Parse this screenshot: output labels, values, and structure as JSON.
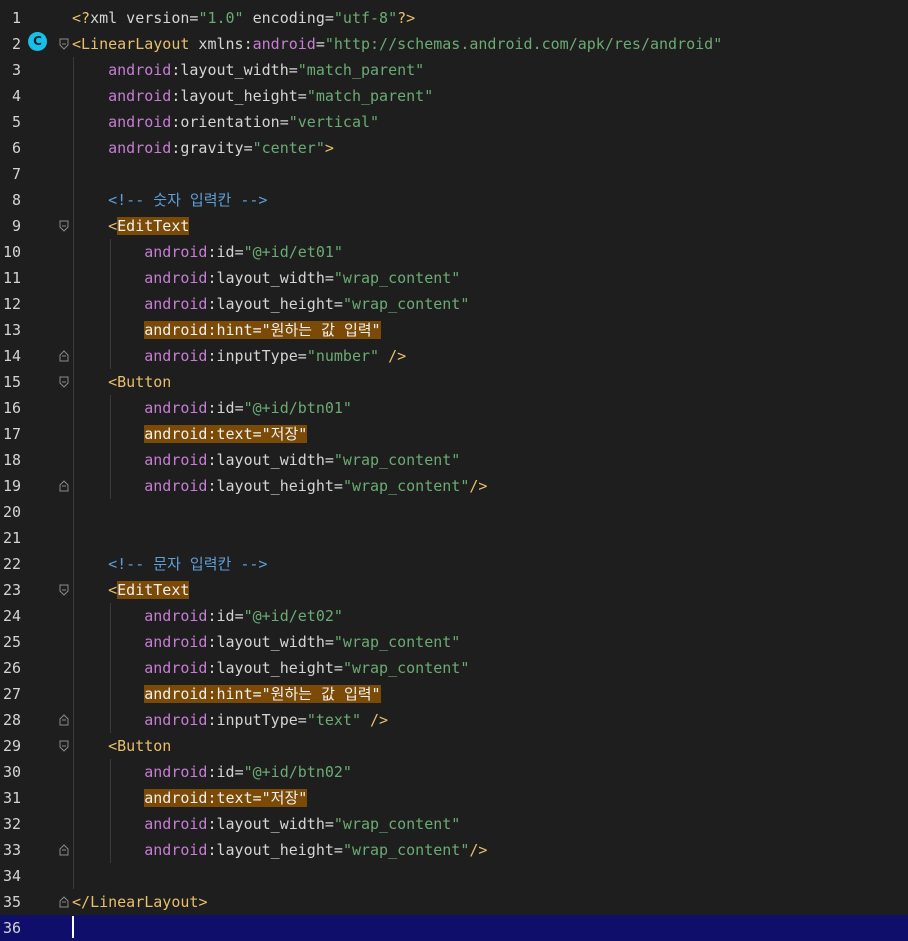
{
  "editor": {
    "gutter_badge": "C",
    "current_line": 36,
    "lines": [
      {
        "n": "1",
        "tokens": [
          [
            "tk-punct",
            "<?"
          ],
          [
            "tk-text",
            "xml version"
          ],
          [
            "tk-eq",
            "="
          ],
          [
            "tk-str",
            "\"1.0\""
          ],
          [
            "tk-text",
            " encoding"
          ],
          [
            "tk-eq",
            "="
          ],
          [
            "tk-str",
            "\"utf-8\""
          ],
          [
            "tk-punct",
            "?>"
          ]
        ]
      },
      {
        "n": "2",
        "tokens": [
          [
            "tk-bracket",
            "<"
          ],
          [
            "tk-tag",
            "LinearLayout"
          ],
          [
            "tk-text",
            " xmlns"
          ],
          [
            "tk-eq",
            ":"
          ],
          [
            "tk-ns",
            "android"
          ],
          [
            "tk-eq",
            "="
          ],
          [
            "tk-str",
            "\"http://schemas.android.com/apk/res/android\""
          ]
        ]
      },
      {
        "n": "3",
        "tokens": [
          [
            "tk-text",
            "    "
          ],
          [
            "tk-ns",
            "android"
          ],
          [
            "tk-eq",
            ":"
          ],
          [
            "tk-attr",
            "layout_width"
          ],
          [
            "tk-eq",
            "="
          ],
          [
            "tk-str",
            "\"match_parent\""
          ]
        ]
      },
      {
        "n": "4",
        "tokens": [
          [
            "tk-text",
            "    "
          ],
          [
            "tk-ns",
            "android"
          ],
          [
            "tk-eq",
            ":"
          ],
          [
            "tk-attr",
            "layout_height"
          ],
          [
            "tk-eq",
            "="
          ],
          [
            "tk-str",
            "\"match_parent\""
          ]
        ]
      },
      {
        "n": "5",
        "tokens": [
          [
            "tk-text",
            "    "
          ],
          [
            "tk-ns",
            "android"
          ],
          [
            "tk-eq",
            ":"
          ],
          [
            "tk-attr",
            "orientation"
          ],
          [
            "tk-eq",
            "="
          ],
          [
            "tk-str",
            "\"vertical\""
          ]
        ]
      },
      {
        "n": "6",
        "tokens": [
          [
            "tk-text",
            "    "
          ],
          [
            "tk-ns",
            "android"
          ],
          [
            "tk-eq",
            ":"
          ],
          [
            "tk-attr",
            "gravity"
          ],
          [
            "tk-eq",
            "="
          ],
          [
            "tk-str",
            "\"center\""
          ],
          [
            "tk-bracket",
            ">"
          ]
        ]
      },
      {
        "n": "7",
        "tokens": []
      },
      {
        "n": "8",
        "tokens": [
          [
            "tk-text",
            "    "
          ],
          [
            "tk-comment",
            "<!-- 숫자 입력칸 -->"
          ]
        ]
      },
      {
        "n": "9",
        "tokens": [
          [
            "tk-text",
            "    "
          ],
          [
            "tk-bracket",
            "<"
          ],
          [
            "tk-tag hl",
            "EditText"
          ]
        ]
      },
      {
        "n": "10",
        "tokens": [
          [
            "tk-text",
            "        "
          ],
          [
            "tk-ns",
            "android"
          ],
          [
            "tk-eq",
            ":"
          ],
          [
            "tk-attr",
            "id"
          ],
          [
            "tk-eq",
            "="
          ],
          [
            "tk-str",
            "\"@+id/et01\""
          ]
        ]
      },
      {
        "n": "11",
        "tokens": [
          [
            "tk-text",
            "        "
          ],
          [
            "tk-ns",
            "android"
          ],
          [
            "tk-eq",
            ":"
          ],
          [
            "tk-attr",
            "layout_width"
          ],
          [
            "tk-eq",
            "="
          ],
          [
            "tk-str",
            "\"wrap_content\""
          ]
        ]
      },
      {
        "n": "12",
        "tokens": [
          [
            "tk-text",
            "        "
          ],
          [
            "tk-ns",
            "android"
          ],
          [
            "tk-eq",
            ":"
          ],
          [
            "tk-attr",
            "layout_height"
          ],
          [
            "tk-eq",
            "="
          ],
          [
            "tk-str",
            "\"wrap_content\""
          ]
        ]
      },
      {
        "n": "13",
        "tokens": [
          [
            "tk-text",
            "        "
          ],
          [
            "hl",
            "android:hint=\"원하는 값 입력\""
          ]
        ]
      },
      {
        "n": "14",
        "tokens": [
          [
            "tk-text",
            "        "
          ],
          [
            "tk-ns",
            "android"
          ],
          [
            "tk-eq",
            ":"
          ],
          [
            "tk-attr",
            "inputType"
          ],
          [
            "tk-eq",
            "="
          ],
          [
            "tk-str",
            "\"number\""
          ],
          [
            "tk-text",
            " "
          ],
          [
            "tk-bracket",
            "/>"
          ]
        ]
      },
      {
        "n": "15",
        "tokens": [
          [
            "tk-text",
            "    "
          ],
          [
            "tk-bracket",
            "<"
          ],
          [
            "tk-tag",
            "Button"
          ]
        ]
      },
      {
        "n": "16",
        "tokens": [
          [
            "tk-text",
            "        "
          ],
          [
            "tk-ns",
            "android"
          ],
          [
            "tk-eq",
            ":"
          ],
          [
            "tk-attr",
            "id"
          ],
          [
            "tk-eq",
            "="
          ],
          [
            "tk-str",
            "\"@+id/btn01\""
          ]
        ]
      },
      {
        "n": "17",
        "tokens": [
          [
            "tk-text",
            "        "
          ],
          [
            "hl",
            "android:text=\"저장\""
          ]
        ]
      },
      {
        "n": "18",
        "tokens": [
          [
            "tk-text",
            "        "
          ],
          [
            "tk-ns",
            "android"
          ],
          [
            "tk-eq",
            ":"
          ],
          [
            "tk-attr",
            "layout_width"
          ],
          [
            "tk-eq",
            "="
          ],
          [
            "tk-str",
            "\"wrap_content\""
          ]
        ]
      },
      {
        "n": "19",
        "tokens": [
          [
            "tk-text",
            "        "
          ],
          [
            "tk-ns",
            "android"
          ],
          [
            "tk-eq",
            ":"
          ],
          [
            "tk-attr",
            "layout_height"
          ],
          [
            "tk-eq",
            "="
          ],
          [
            "tk-str",
            "\"wrap_content\""
          ],
          [
            "tk-bracket",
            "/>"
          ]
        ]
      },
      {
        "n": "20",
        "tokens": []
      },
      {
        "n": "21",
        "tokens": []
      },
      {
        "n": "22",
        "tokens": [
          [
            "tk-text",
            "    "
          ],
          [
            "tk-comment",
            "<!-- 문자 입력칸 -->"
          ]
        ]
      },
      {
        "n": "23",
        "tokens": [
          [
            "tk-text",
            "    "
          ],
          [
            "tk-bracket",
            "<"
          ],
          [
            "tk-tag hl",
            "EditText"
          ]
        ]
      },
      {
        "n": "24",
        "tokens": [
          [
            "tk-text",
            "        "
          ],
          [
            "tk-ns",
            "android"
          ],
          [
            "tk-eq",
            ":"
          ],
          [
            "tk-attr",
            "id"
          ],
          [
            "tk-eq",
            "="
          ],
          [
            "tk-str",
            "\"@+id/et02\""
          ]
        ]
      },
      {
        "n": "25",
        "tokens": [
          [
            "tk-text",
            "        "
          ],
          [
            "tk-ns",
            "android"
          ],
          [
            "tk-eq",
            ":"
          ],
          [
            "tk-attr",
            "layout_width"
          ],
          [
            "tk-eq",
            "="
          ],
          [
            "tk-str",
            "\"wrap_content\""
          ]
        ]
      },
      {
        "n": "26",
        "tokens": [
          [
            "tk-text",
            "        "
          ],
          [
            "tk-ns",
            "android"
          ],
          [
            "tk-eq",
            ":"
          ],
          [
            "tk-attr",
            "layout_height"
          ],
          [
            "tk-eq",
            "="
          ],
          [
            "tk-str",
            "\"wrap_content\""
          ]
        ]
      },
      {
        "n": "27",
        "tokens": [
          [
            "tk-text",
            "        "
          ],
          [
            "hl",
            "android:hint=\"원하는 값 입력\""
          ]
        ]
      },
      {
        "n": "28",
        "tokens": [
          [
            "tk-text",
            "        "
          ],
          [
            "tk-ns",
            "android"
          ],
          [
            "tk-eq",
            ":"
          ],
          [
            "tk-attr",
            "inputType"
          ],
          [
            "tk-eq",
            "="
          ],
          [
            "tk-str",
            "\"text\""
          ],
          [
            "tk-text",
            " "
          ],
          [
            "tk-bracket",
            "/>"
          ]
        ]
      },
      {
        "n": "29",
        "tokens": [
          [
            "tk-text",
            "    "
          ],
          [
            "tk-bracket",
            "<"
          ],
          [
            "tk-tag",
            "Button"
          ]
        ]
      },
      {
        "n": "30",
        "tokens": [
          [
            "tk-text",
            "        "
          ],
          [
            "tk-ns",
            "android"
          ],
          [
            "tk-eq",
            ":"
          ],
          [
            "tk-attr",
            "id"
          ],
          [
            "tk-eq",
            "="
          ],
          [
            "tk-str",
            "\"@+id/btn02\""
          ]
        ]
      },
      {
        "n": "31",
        "tokens": [
          [
            "tk-text",
            "        "
          ],
          [
            "hl",
            "android:text=\"저장\""
          ]
        ]
      },
      {
        "n": "32",
        "tokens": [
          [
            "tk-text",
            "        "
          ],
          [
            "tk-ns",
            "android"
          ],
          [
            "tk-eq",
            ":"
          ],
          [
            "tk-attr",
            "layout_width"
          ],
          [
            "tk-eq",
            "="
          ],
          [
            "tk-str",
            "\"wrap_content\""
          ]
        ]
      },
      {
        "n": "33",
        "tokens": [
          [
            "tk-text",
            "        "
          ],
          [
            "tk-ns",
            "android"
          ],
          [
            "tk-eq",
            ":"
          ],
          [
            "tk-attr",
            "layout_height"
          ],
          [
            "tk-eq",
            "="
          ],
          [
            "tk-str",
            "\"wrap_content\""
          ],
          [
            "tk-bracket",
            "/>"
          ]
        ]
      },
      {
        "n": "34",
        "tokens": []
      },
      {
        "n": "35",
        "tokens": [
          [
            "tk-bracket",
            "</"
          ],
          [
            "tk-tag",
            "LinearLayout"
          ],
          [
            "tk-bracket",
            ">"
          ]
        ]
      },
      {
        "n": "36",
        "tokens": []
      }
    ]
  }
}
